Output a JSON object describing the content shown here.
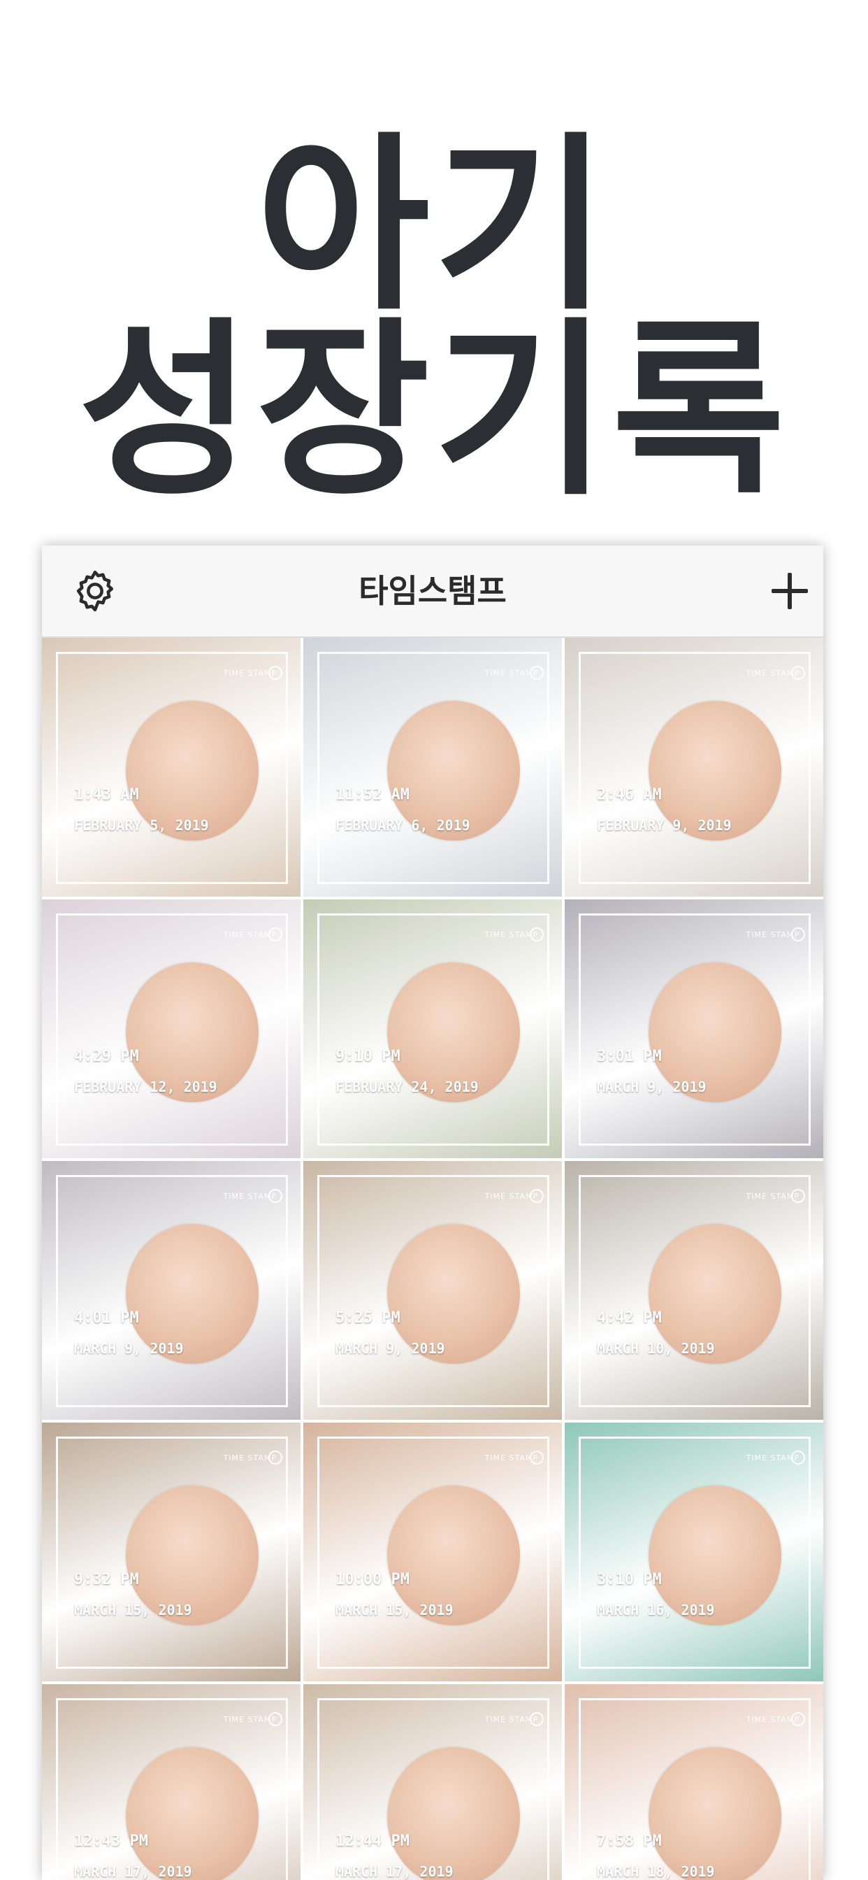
{
  "headline": {
    "line1": "아기",
    "line2": "성장기록"
  },
  "app_bar": {
    "title": "타임스탬프",
    "settings_icon": "gear-icon",
    "add_icon": "plus-icon"
  },
  "tiles": [
    {
      "time": "1:43 AM",
      "date": "FEBRUARY 5, 2019",
      "stamp": "TIME STAMP",
      "bg": "#d9c8b6"
    },
    {
      "time": "11:52 AM",
      "date": "FEBRUARY 6, 2019",
      "stamp": "TIME STAMP",
      "bg": "#cfd4d9"
    },
    {
      "time": "2:46 AM",
      "date": "FEBRUARY 9, 2019",
      "stamp": "TIME STAMP",
      "bg": "#d7d0c9"
    },
    {
      "time": "4:29 PM",
      "date": "FEBRUARY 12, 2019",
      "stamp": "TIME STAMP",
      "bg": "#dbd2d8"
    },
    {
      "time": "9:10 PM",
      "date": "FEBRUARY 24, 2019",
      "stamp": "TIME STAMP",
      "bg": "#c6cbb6"
    },
    {
      "time": "3:01 PM",
      "date": "MARCH 9, 2019",
      "stamp": "TIME STAMP",
      "bg": "#b3b1b8"
    },
    {
      "time": "4:01 PM",
      "date": "MARCH 9, 2019",
      "stamp": "TIME STAMP",
      "bg": "#bfbcc0"
    },
    {
      "time": "5:25 PM",
      "date": "MARCH 9, 2019",
      "stamp": "TIME STAMP",
      "bg": "#c8b8a4"
    },
    {
      "time": "4:42 PM",
      "date": "MARCH 10, 2019",
      "stamp": "TIME STAMP",
      "bg": "#b9b3a8"
    },
    {
      "time": "9:32 PM",
      "date": "MARCH 15, 2019",
      "stamp": "TIME STAMP",
      "bg": "#bca894"
    },
    {
      "time": "10:00 PM",
      "date": "MARCH 15, 2019",
      "stamp": "TIME STAMP",
      "bg": "#d6b49c"
    },
    {
      "time": "3:10 PM",
      "date": "MARCH 16, 2019",
      "stamp": "TIME STAMP",
      "bg": "#8fc7b8"
    },
    {
      "time": "12:43 PM",
      "date": "MARCH 17, 2019",
      "stamp": "TIME STAMP",
      "bg": "#c9b6a4"
    },
    {
      "time": "12:44 PM",
      "date": "MARCH 17, 2019",
      "stamp": "TIME STAMP",
      "bg": "#cdbba7"
    },
    {
      "time": "7:58 PM",
      "date": "MARCH 18, 2019",
      "stamp": "TIME STAMP",
      "bg": "#e0bfad"
    }
  ]
}
